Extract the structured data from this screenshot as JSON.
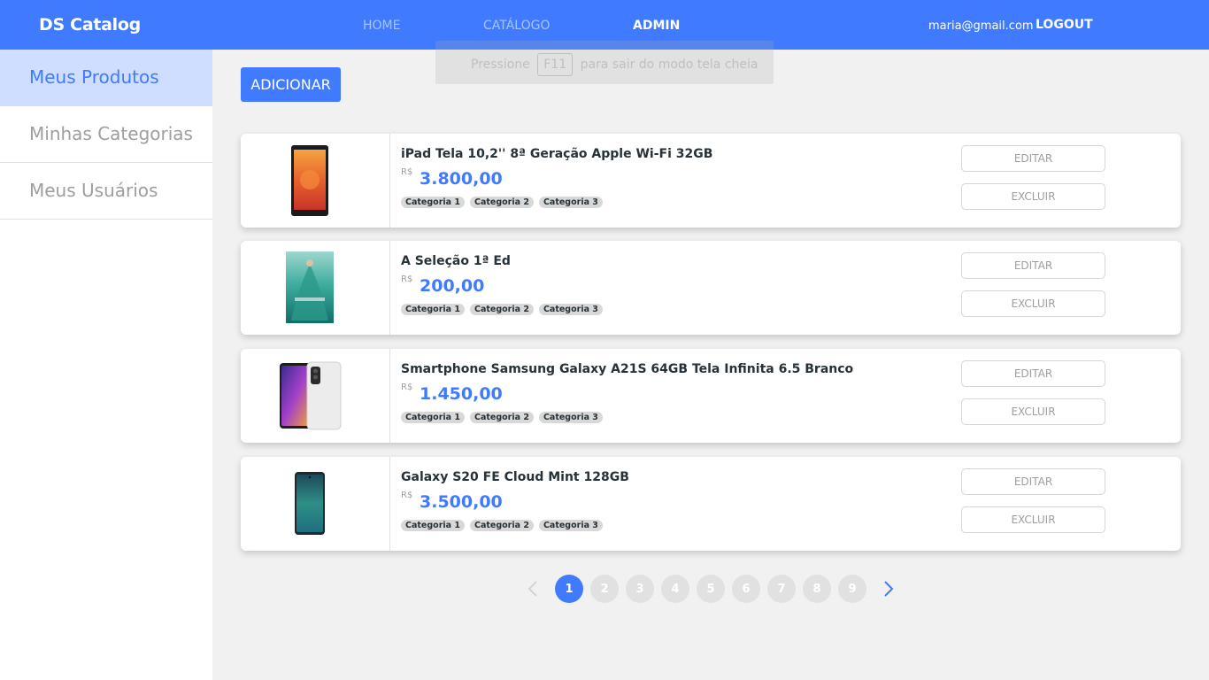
{
  "navbar": {
    "brand": "DS Catalog",
    "links": [
      "HOME",
      "CATÁLOGO",
      "ADMIN"
    ],
    "user_email": "maria@gmail.com",
    "logout": "LOGOUT"
  },
  "toast": {
    "before": "Pressione",
    "key": "F11",
    "after": "para sair do modo tela cheia"
  },
  "sidebar": {
    "items": [
      {
        "label": "Meus Produtos"
      },
      {
        "label": "Minhas Categorias"
      },
      {
        "label": "Meus Usuários"
      }
    ]
  },
  "main": {
    "add_label": "ADICIONAR",
    "edit_label": "EDITAR",
    "delete_label": "EXCLUIR",
    "currency": "R$",
    "products": [
      {
        "name": "iPad Tela 10,2'' 8ª Geração Apple Wi-Fi 32GB",
        "price": "3.800,00",
        "categories": [
          "Categoria 1",
          "Categoria 2",
          "Categoria 3"
        ]
      },
      {
        "name": "A Seleção 1ª Ed",
        "price": "200,00",
        "categories": [
          "Categoria 1",
          "Categoria 2",
          "Categoria 3"
        ]
      },
      {
        "name": "Smartphone Samsung Galaxy A21S 64GB Tela Infinita 6.5 Branco",
        "price": "1.450,00",
        "categories": [
          "Categoria 1",
          "Categoria 2",
          "Categoria 3"
        ]
      },
      {
        "name": "Galaxy S20 FE Cloud Mint 128GB",
        "price": "3.500,00",
        "categories": [
          "Categoria 1",
          "Categoria 2",
          "Categoria 3"
        ]
      }
    ]
  },
  "pagination": {
    "pages": [
      "1",
      "2",
      "3",
      "4",
      "5",
      "6",
      "7",
      "8",
      "9"
    ],
    "current": "1"
  },
  "colors": {
    "primary": "#407bff",
    "sidebar_active_bg": "#cfdeff",
    "background": "#f1f1f1"
  }
}
